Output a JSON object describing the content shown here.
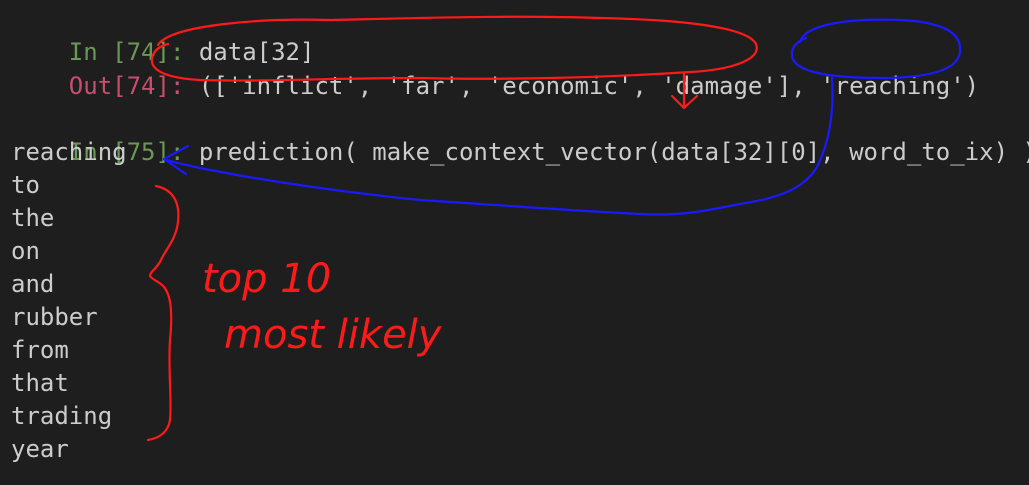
{
  "cells": {
    "in74": {
      "prompt_label": "In [",
      "prompt_num": "74",
      "prompt_end": "]: ",
      "code": "data[32]"
    },
    "out74": {
      "prompt_label": "Out[",
      "prompt_num": "74",
      "prompt_end": "]: ",
      "code": "(['inflict', 'far', 'economic', 'damage'], 'reaching')"
    },
    "in75": {
      "prompt_label": "In [",
      "prompt_num": "75",
      "prompt_end": "]: ",
      "code": "prediction( make_context_vector(data[32][0], word_to_ix) )"
    }
  },
  "predictions": [
    "reaching",
    "to",
    "the",
    "on",
    "and",
    "rubber",
    "from",
    "that",
    "trading",
    "year"
  ],
  "annotation": {
    "line1": "top 10",
    "line2": "most likely"
  },
  "colors": {
    "background": "#1e1e1e",
    "in_prompt": "#6a9955",
    "out_prompt": "#c74e6e",
    "text": "#cccccc",
    "red_ink": "#ff1a1a",
    "blue_ink": "#1a1aff"
  }
}
